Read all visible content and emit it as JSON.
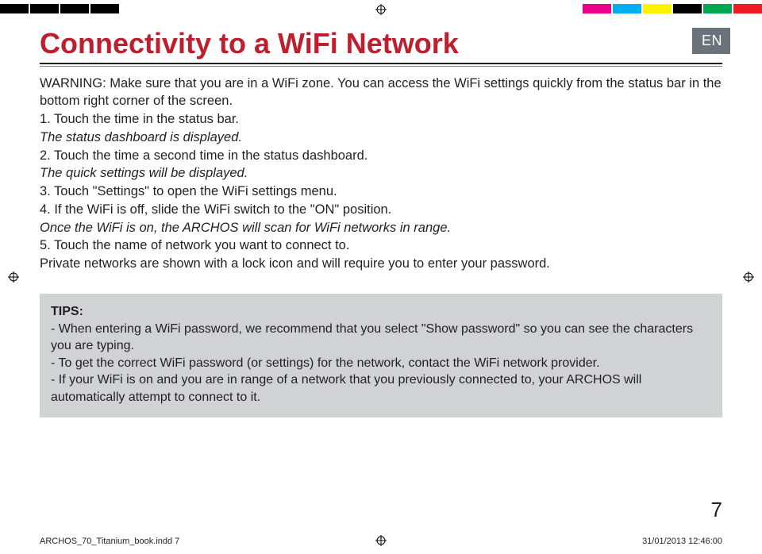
{
  "lang_badge": "EN",
  "title": "Connectivity to a WiFi Network",
  "warning": "WARNING: Make sure that you are in a WiFi zone. You can access the WiFi settings quickly from the status bar in the bottom right corner of the screen.",
  "steps": {
    "s1": "1. Touch the time in the status bar.",
    "s1_note": "The status dashboard is displayed.",
    "s2": "2. Touch the time a second time in the status dashboard.",
    "s2_note": "The quick settings will be displayed.",
    "s3": "3. Touch \"Settings\" to open the WiFi settings menu.",
    "s4": "4. If the WiFi is off, slide the WiFi switch to the \"ON\" position.",
    "s4_note": "Once the WiFi is on, the ARCHOS will scan for WiFi networks in range.",
    "s5": "5. Touch the name of network you want to connect to.",
    "s5_note": "Private networks are shown with a lock icon and will require you to enter your password."
  },
  "tips": {
    "head": "TIPS:",
    "t1": "-   When entering a WiFi password, we recommend that you select \"Show password\" so you can see the characters you are typing.",
    "t2": "-   To get the correct WiFi password (or settings) for the network, contact the WiFi network provider.",
    "t3": "-   If your WiFi is on and you are in range of a network that you previously connected to, your ARCHOS will automatically attempt to connect to it."
  },
  "page_number": "7",
  "footer": {
    "file": "ARCHOS_70_Titanium_book.indd   7",
    "stamp": "31/01/2013   12:46:00"
  },
  "reg_colors": [
    "#000000",
    "#000000",
    "#000000",
    "#000000",
    "#ffffff",
    "#ffffff",
    "#ec008c",
    "#00aeef",
    "#fff200",
    "#000000",
    "#00a651",
    "#ed1c24"
  ]
}
